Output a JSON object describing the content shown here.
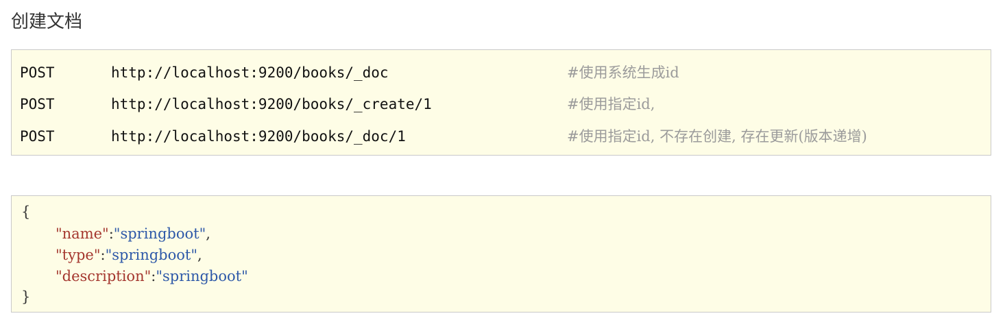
{
  "page": {
    "title": "创建文档"
  },
  "requests": [
    {
      "method": "POST",
      "url": "http://localhost:9200/books/_doc",
      "comment": "#使用系统生成id"
    },
    {
      "method": "POST",
      "url": "http://localhost:9200/books/_create/1",
      "comment": "#使用指定id,"
    },
    {
      "method": "POST",
      "url": "http://localhost:9200/books/_doc/1",
      "comment": "#使用指定id, 不存在创建, 存在更新(版本递增)"
    }
  ],
  "body": {
    "open_brace": "{",
    "close_brace": "}",
    "fields": [
      {
        "key": "\"name\"",
        "sep": ":",
        "value": "\"springboot\"",
        "trail": ","
      },
      {
        "key": "\"type\"",
        "sep": ":",
        "value": "\"springboot\"",
        "trail": ","
      },
      {
        "key": "\"description\"",
        "sep": ":",
        "value": "\"springboot\"",
        "trail": ""
      }
    ]
  },
  "colors": {
    "box_background": "#fefde6",
    "box_border": "#c9c9c9",
    "json_key": "#a4362e",
    "json_value": "#2d58a8",
    "comment": "#9b9b9b"
  }
}
